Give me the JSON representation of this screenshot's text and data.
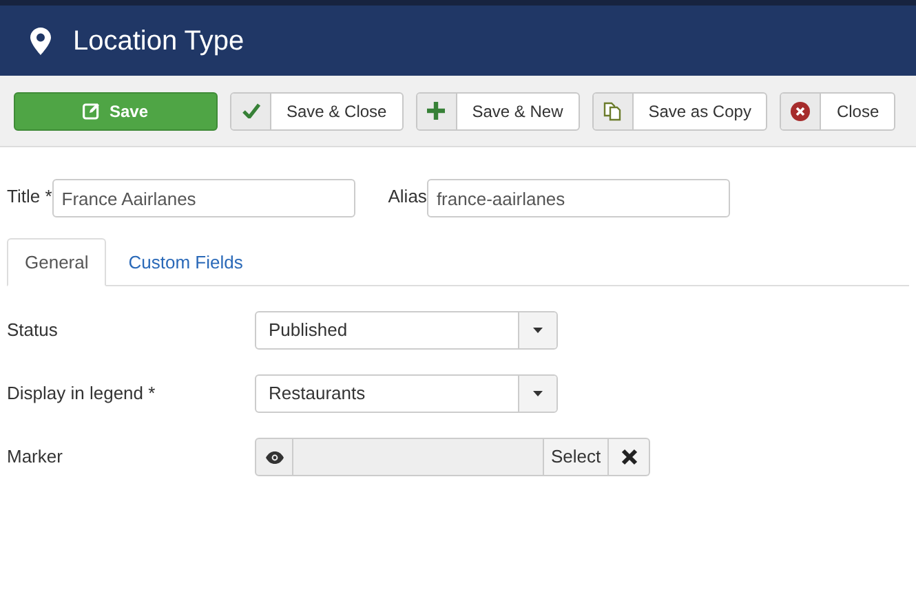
{
  "header": {
    "title": "Location Type"
  },
  "toolbar": [
    {
      "kind": "save",
      "label": "Save"
    },
    {
      "kind": "check",
      "label": "Save & Close"
    },
    {
      "kind": "plus",
      "label": "Save & New"
    },
    {
      "kind": "copy",
      "label": "Save as Copy"
    },
    {
      "kind": "close",
      "label": "Close"
    }
  ],
  "top_fields": [
    {
      "label": "Title *",
      "value": "France Aairlanes"
    },
    {
      "label": "Alias",
      "value": "france-aairlanes"
    }
  ],
  "tabs": [
    {
      "label": "General",
      "selected": true
    },
    {
      "label": "Custom Fields",
      "selected": false
    }
  ],
  "fields": [
    {
      "kind": "select",
      "label": "Status",
      "value": "Published"
    },
    {
      "kind": "select",
      "label": "Display in legend *",
      "value": "Restaurants"
    },
    {
      "kind": "media",
      "label": "Marker",
      "button": "Select"
    }
  ]
}
